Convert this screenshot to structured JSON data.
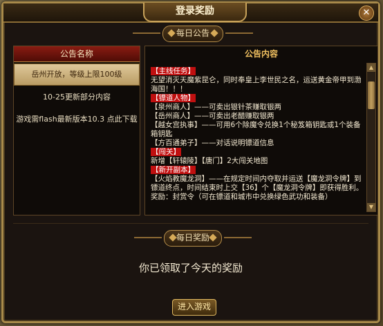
{
  "window": {
    "title": "登录奖励",
    "close_glyph": "✕"
  },
  "daily_notice": {
    "ribbon": "每日公告"
  },
  "notice_list": {
    "header": "公告名称",
    "items": [
      {
        "label": "岳州开放，等级上限100级",
        "active": true
      },
      {
        "label": "10-25更新部分内容",
        "active": false
      },
      {
        "label": "游戏需flash最新版本10.3 点此下载",
        "active": false
      }
    ]
  },
  "notice_content": {
    "header": "公告内容",
    "lines": [
      {
        "tag": "【主线任务】",
        "text": ""
      },
      {
        "tag": "",
        "text": "无望消灭天魔紫昆仑，同时奉皇上李世民之名，运送黄金帝甲到渤海国！！！"
      },
      {
        "tag": "【镖道人物】",
        "text": ""
      },
      {
        "tag": "",
        "text": "【泉州商人】——可卖出银针茶赚取银两"
      },
      {
        "tag": "",
        "text": "【岳州商人】——可卖出老醋赚取银两"
      },
      {
        "tag": "",
        "text": "【越女宫执事】——可用6个除魔令兑换1个秘笈箱钥匙或1个装备箱钥匙"
      },
      {
        "tag": "",
        "text": "【方百通弟子】——对话说明镖道信息"
      },
      {
        "tag": "【闯关】",
        "text": ""
      },
      {
        "tag": "",
        "text": "新增【轩辕陵】【唐门】2大闯关地图"
      },
      {
        "tag": "【新开副本】",
        "text": ""
      },
      {
        "tag": "",
        "text": "【火焰教魔龙洞】——在规定时间内夺取并运送【魔龙洞令牌】到镖道终点，时间结束时上交【36】个【魔龙洞令牌】即获得胜利。奖励：封赏令（可在镖道和城市中兑换绿色武功和装备）"
      }
    ]
  },
  "daily_reward": {
    "ribbon": "每日奖励",
    "message": "你已领取了今天的奖励"
  },
  "enter_button": "进入游戏"
}
